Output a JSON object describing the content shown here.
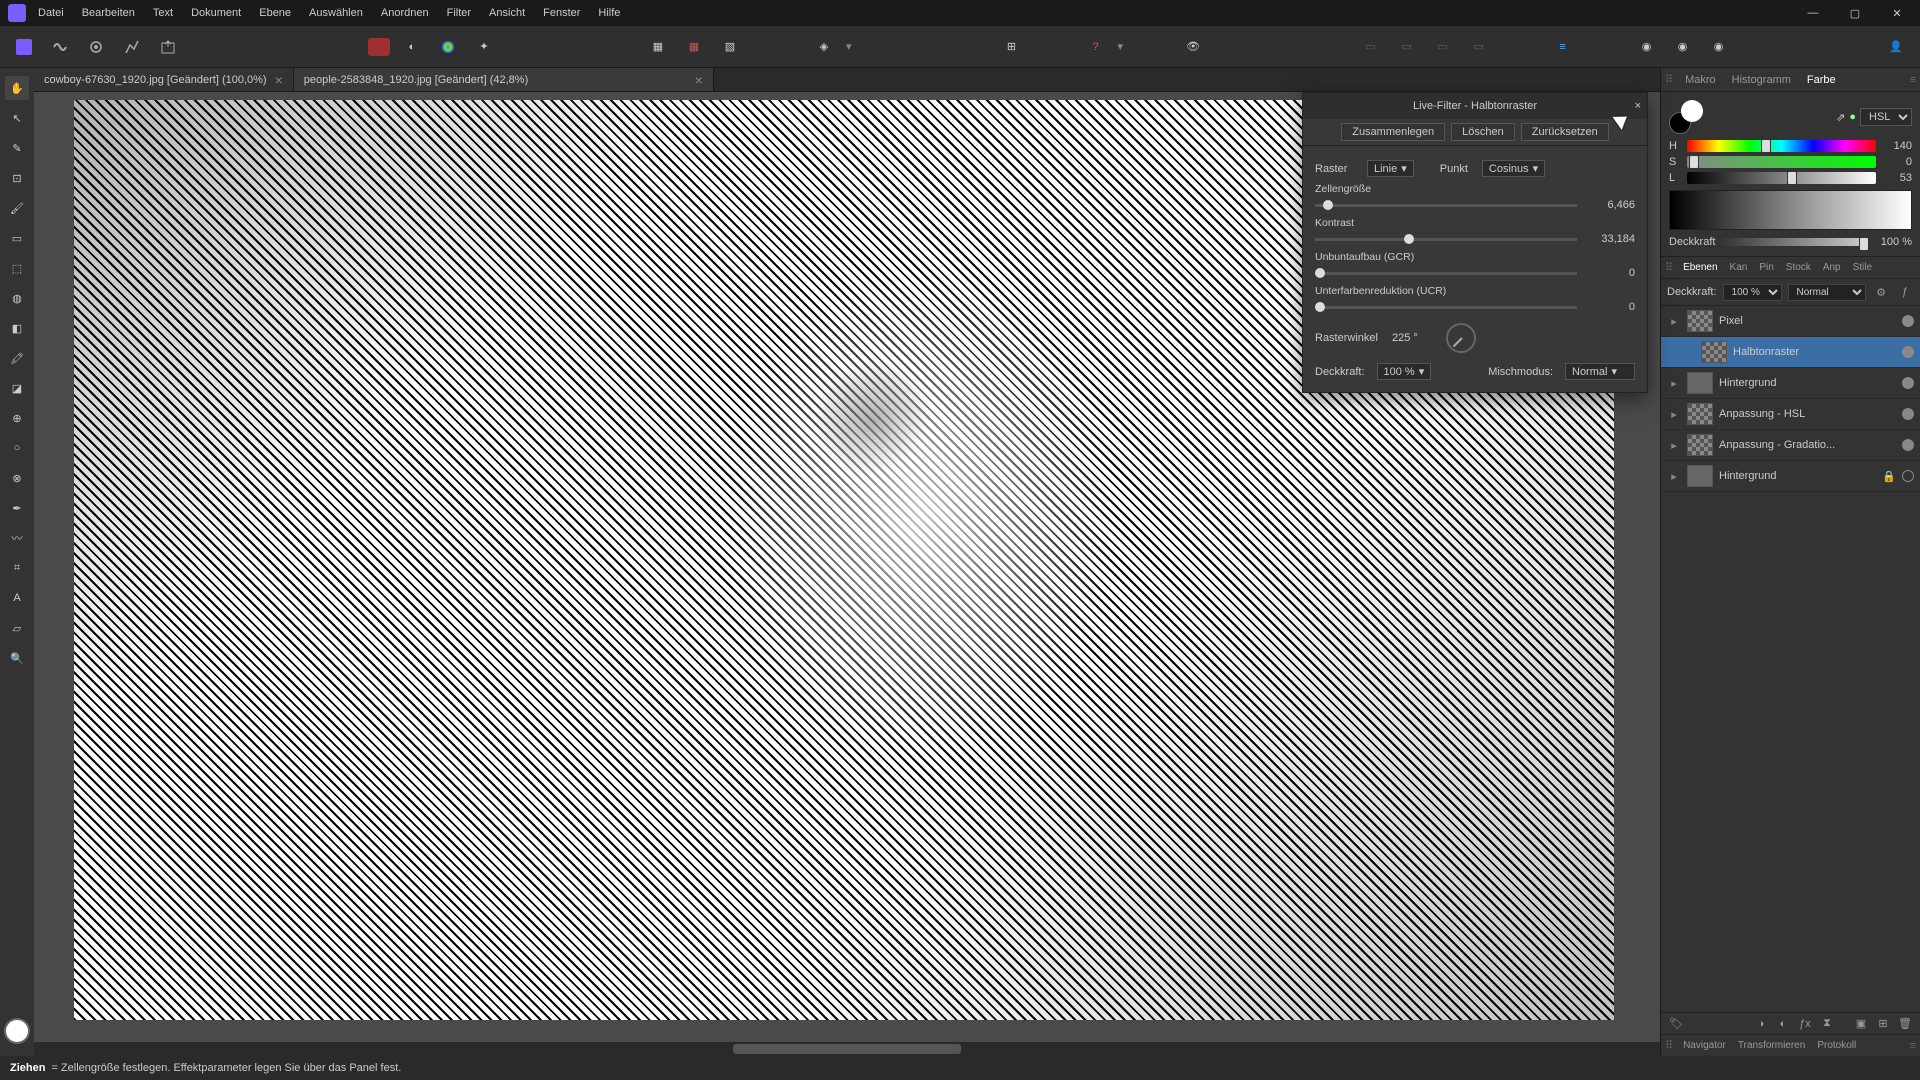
{
  "menu": [
    "Datei",
    "Bearbeiten",
    "Text",
    "Dokument",
    "Ebene",
    "Auswählen",
    "Anordnen",
    "Filter",
    "Ansicht",
    "Fenster",
    "Hilfe"
  ],
  "tabs": [
    {
      "label": "cowboy-67630_1920.jpg [Geändert] (100,0%)"
    },
    {
      "label": "people-2583848_1920.jpg [Geändert] (42,8%)"
    }
  ],
  "rightTabs1": [
    "Makro",
    "Histogramm",
    "Farbe"
  ],
  "hsl": {
    "mode": "HSL",
    "h": {
      "val": "140",
      "pct": 39
    },
    "s": {
      "val": "0",
      "pct": 1
    },
    "l": {
      "val": "53",
      "pct": 53
    }
  },
  "opacity": {
    "label": "Deckkraft",
    "val": "100 %",
    "pct": 95
  },
  "layerTabs": [
    "Ebenen",
    "Kan",
    "Pin",
    "Stock",
    "Anp",
    "Stile"
  ],
  "layerOpts": {
    "op": "Deckkraft:",
    "opval": "100 %",
    "blend": "Normal"
  },
  "layers": [
    {
      "name": "Pixel",
      "sel": false,
      "child": false,
      "chk": true
    },
    {
      "name": "Halbtonraster",
      "sel": true,
      "child": true,
      "chk": true
    },
    {
      "name": "Hintergrund",
      "sel": false,
      "child": false,
      "chk": false
    },
    {
      "name": "Anpassung - HSL",
      "sel": false,
      "child": false,
      "chk": true
    },
    {
      "name": "Anpassung - Gradatio...",
      "sel": false,
      "child": false,
      "chk": true
    },
    {
      "name": "Hintergrund",
      "sel": false,
      "child": false,
      "chk": false,
      "locked": true
    }
  ],
  "bottomTabs": [
    "Navigator",
    "Transformieren",
    "Protokoll"
  ],
  "dialog": {
    "title": "Live-Filter - Halbtonraster",
    "btns": [
      "Zusammenlegen",
      "Löschen",
      "Zurücksetzen"
    ],
    "raster": {
      "label": "Raster",
      "sel": "Linie"
    },
    "punkt": {
      "label": "Punkt",
      "sel": "Cosinus"
    },
    "sliders": [
      {
        "label": "Zellengröße",
        "val": "6,466",
        "pct": 3
      },
      {
        "label": "Kontrast",
        "val": "33,184",
        "pct": 34
      },
      {
        "label": "Unbuntaufbau (GCR)",
        "val": "0",
        "pct": 0
      },
      {
        "label": "Unterfarbenreduktion (UCR)",
        "val": "0",
        "pct": 0
      }
    ],
    "angle": {
      "label": "Rasterwinkel",
      "val": "225 °"
    },
    "opacity": {
      "label": "Deckkraft:",
      "val": "100 %"
    },
    "blend": {
      "label": "Mischmodus:",
      "val": "Normal"
    }
  },
  "status": {
    "bold": "Ziehen",
    "rest": " = Zellengröße festlegen. Effektparameter legen Sie über das Panel fest."
  }
}
